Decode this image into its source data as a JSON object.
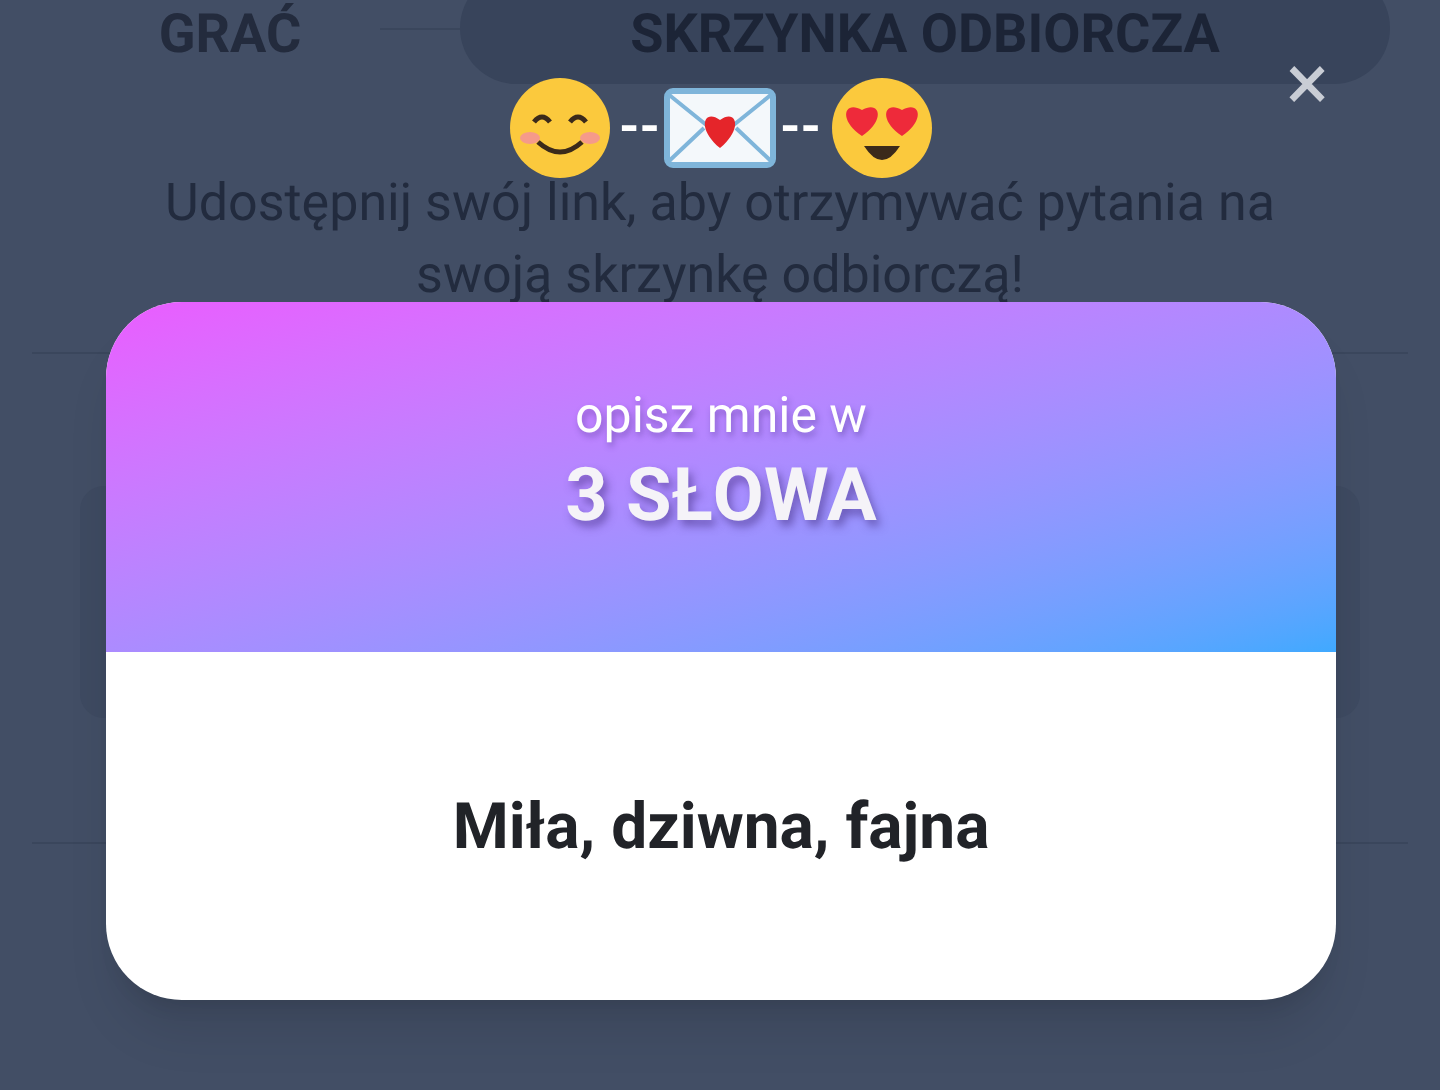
{
  "background": {
    "tabs": [
      {
        "label": "GRAĆ",
        "selected": false
      },
      {
        "label": "SKRZYNKA ODBIORCZA",
        "selected": true
      }
    ],
    "description": "Udostępnij swój link, aby otrzymywać pytania na swoją skrzynkę odbiorczą!"
  },
  "dialog": {
    "separators": [
      "--",
      "--"
    ],
    "close": "×",
    "prompt": "opisz mnie w",
    "topic": "3 SŁOWA",
    "answer": "Miła, dziwna, fajna"
  }
}
